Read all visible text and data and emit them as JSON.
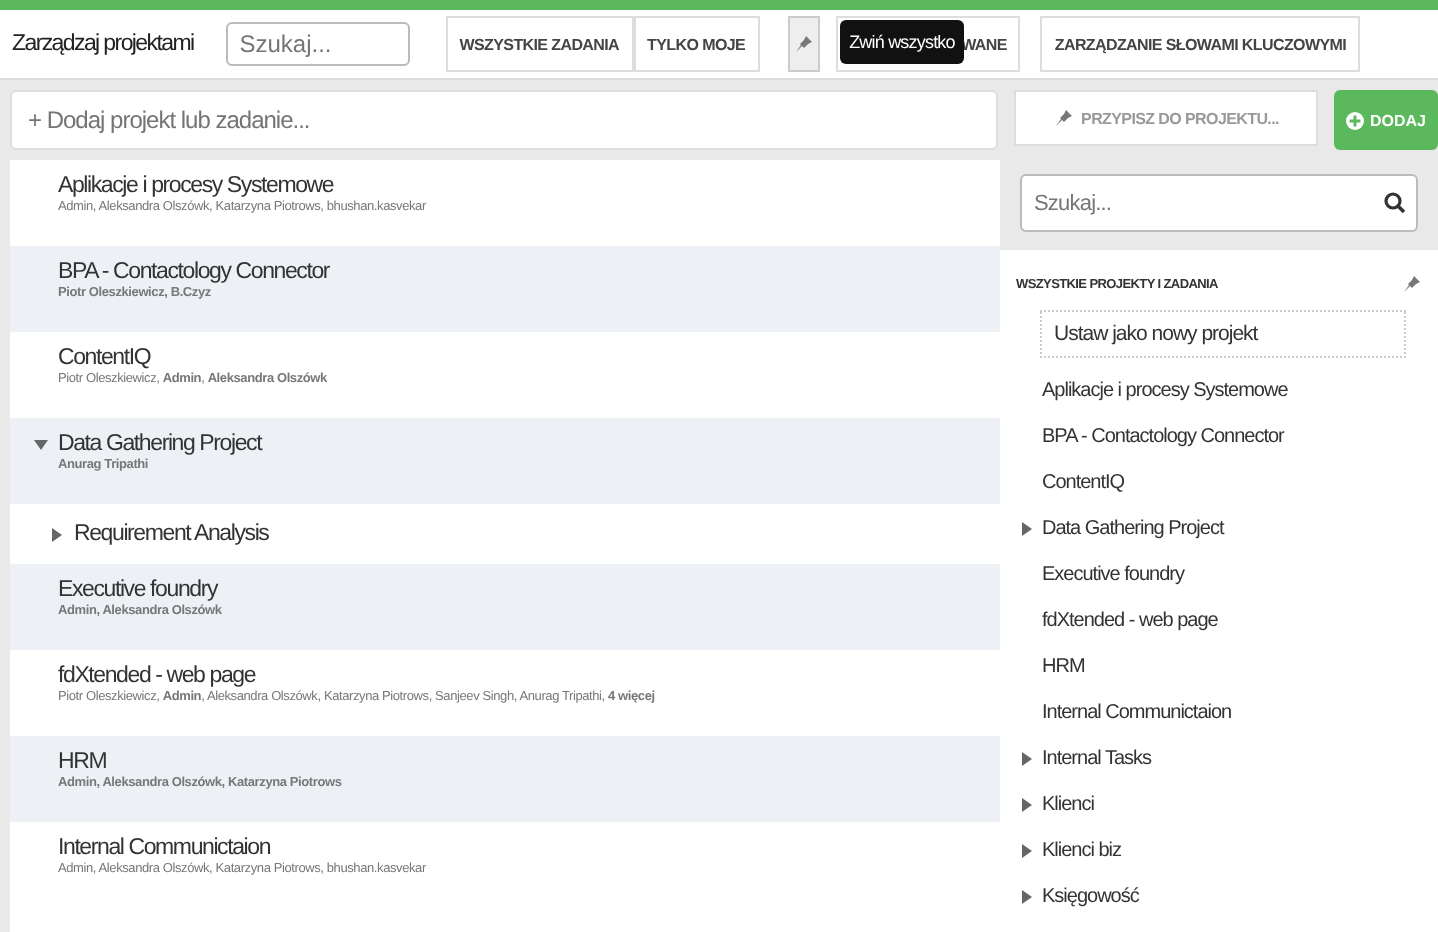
{
  "toolbar": {
    "title": "Zarządzaj projektami",
    "search": {
      "placeholder": "Szukaj..."
    },
    "filter_tabs": [
      {
        "label": "WSZYSTKIE ZADANIA",
        "selected": false
      },
      {
        "label": "TYLKO MOJE",
        "selected": false
      }
    ],
    "collapse_tooltip": "Zwiń wszystko",
    "hidden_button": "WANE",
    "keywords_button": "ZARZĄDZANIE SŁOWAMI KLUCZOWYMI"
  },
  "add_bar": {
    "placeholder": "+ Dodaj projekt lub zadanie...",
    "assign_button": "PRZYPISZ DO PROJEKTU...",
    "add_button": "DODAJ"
  },
  "projects": [
    {
      "name": "Aplikacje i procesy Systemowe",
      "members": "Admin, Aleksandra Olszówk, Katarzyna Piotrows, bhushan.kasvekar",
      "members_bold": false,
      "kind": "leaf"
    },
    {
      "name": "BPA - Contactology Connector",
      "members": "Piotr Oleszkiewicz, B.Czyz",
      "members_bold": true,
      "kind": "leaf"
    },
    {
      "name": "ContentIQ",
      "members": "Piotr Oleszkiewicz, **Admin**, **Aleksandra Olszówk**",
      "members_bold": false,
      "kind": "leaf"
    },
    {
      "name": "Data Gathering Project",
      "members": "Anurag Tripathi",
      "members_bold": true,
      "kind": "group",
      "expanded": true,
      "children": [
        {
          "name": "Requirement Analysis",
          "kind": "group",
          "expanded": false
        }
      ]
    },
    {
      "name": "Executive foundry",
      "members": "Admin, Aleksandra Olszówk",
      "members_bold": true,
      "kind": "leaf"
    },
    {
      "name": "fdXtended - web page",
      "members": "Piotr Oleszkiewicz, **Admin**, Aleksandra Olszówk, Katarzyna Piotrows, Sanjeev Singh, Anurag Tripathi, **4 więcej**",
      "members_bold": false,
      "kind": "leaf"
    },
    {
      "name": "HRM",
      "members": "Admin, Aleksandra Olszówk, Katarzyna Piotrows",
      "members_bold": true,
      "kind": "leaf"
    },
    {
      "name": "Internal Communictaion",
      "members": "Admin, Aleksandra Olszówk, Katarzyna Piotrows, bhushan.kasvekar",
      "members_bold": false,
      "kind": "leaf"
    }
  ],
  "side_panel": {
    "search": {
      "placeholder": "Szukaj..."
    },
    "heading": "WSZYSTKIE PROJEKTY I ZADANIA",
    "new_project": "Ustaw jako nowy projekt",
    "tree": [
      {
        "name": "Aplikacje i procesy Systemowe",
        "kind": "leaf"
      },
      {
        "name": "BPA - Contactology Connector",
        "kind": "leaf"
      },
      {
        "name": "ContentIQ",
        "kind": "leaf"
      },
      {
        "name": "Data Gathering Project",
        "kind": "group"
      },
      {
        "name": "Executive foundry",
        "kind": "leaf"
      },
      {
        "name": "fdXtended - web page",
        "kind": "leaf"
      },
      {
        "name": "HRM",
        "kind": "leaf"
      },
      {
        "name": "Internal Communictaion",
        "kind": "leaf"
      },
      {
        "name": "Internal Tasks",
        "kind": "group"
      },
      {
        "name": "Klienci",
        "kind": "group"
      },
      {
        "name": "Klienci biz",
        "kind": "group"
      },
      {
        "name": "Księgowość",
        "kind": "group"
      }
    ]
  }
}
